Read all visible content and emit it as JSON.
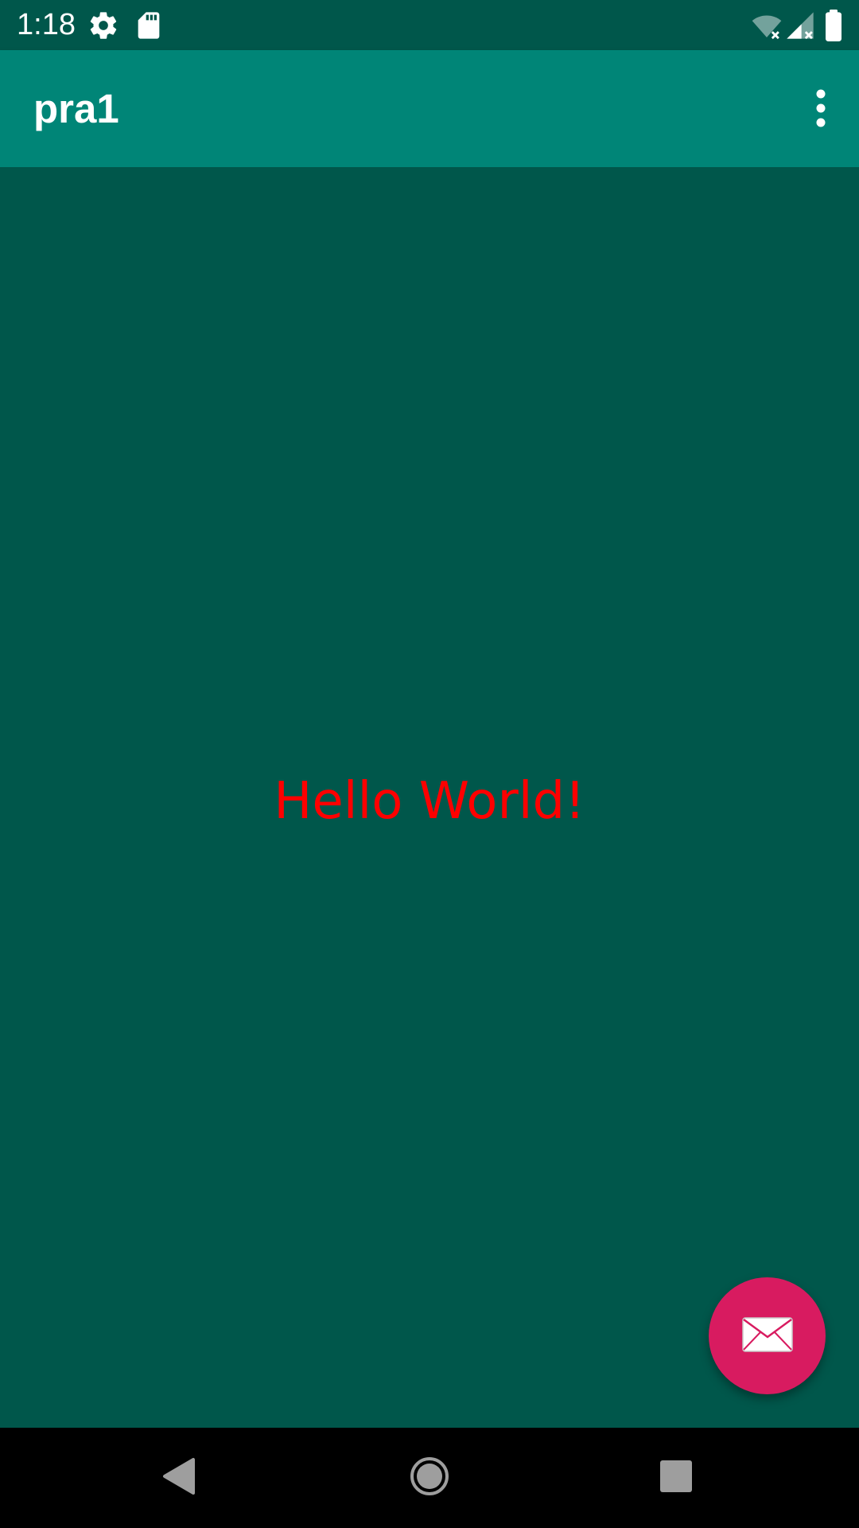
{
  "status_bar": {
    "time": "1:18",
    "icons": [
      "gear-icon",
      "sd-card-icon",
      "wifi-off-icon",
      "signal-off-icon",
      "battery-icon"
    ]
  },
  "app_bar": {
    "title": "pra1",
    "overflow_icon": "more-vert-icon"
  },
  "content": {
    "message": "Hello World!",
    "message_color": "#FF0000"
  },
  "fab": {
    "icon": "email-icon",
    "color": "#D81B60"
  },
  "nav_bar": {
    "buttons": [
      "back-icon",
      "home-icon",
      "recents-icon"
    ]
  },
  "colors": {
    "primary": "#008577",
    "primary_dark": "#00574B",
    "accent": "#D81B60"
  }
}
